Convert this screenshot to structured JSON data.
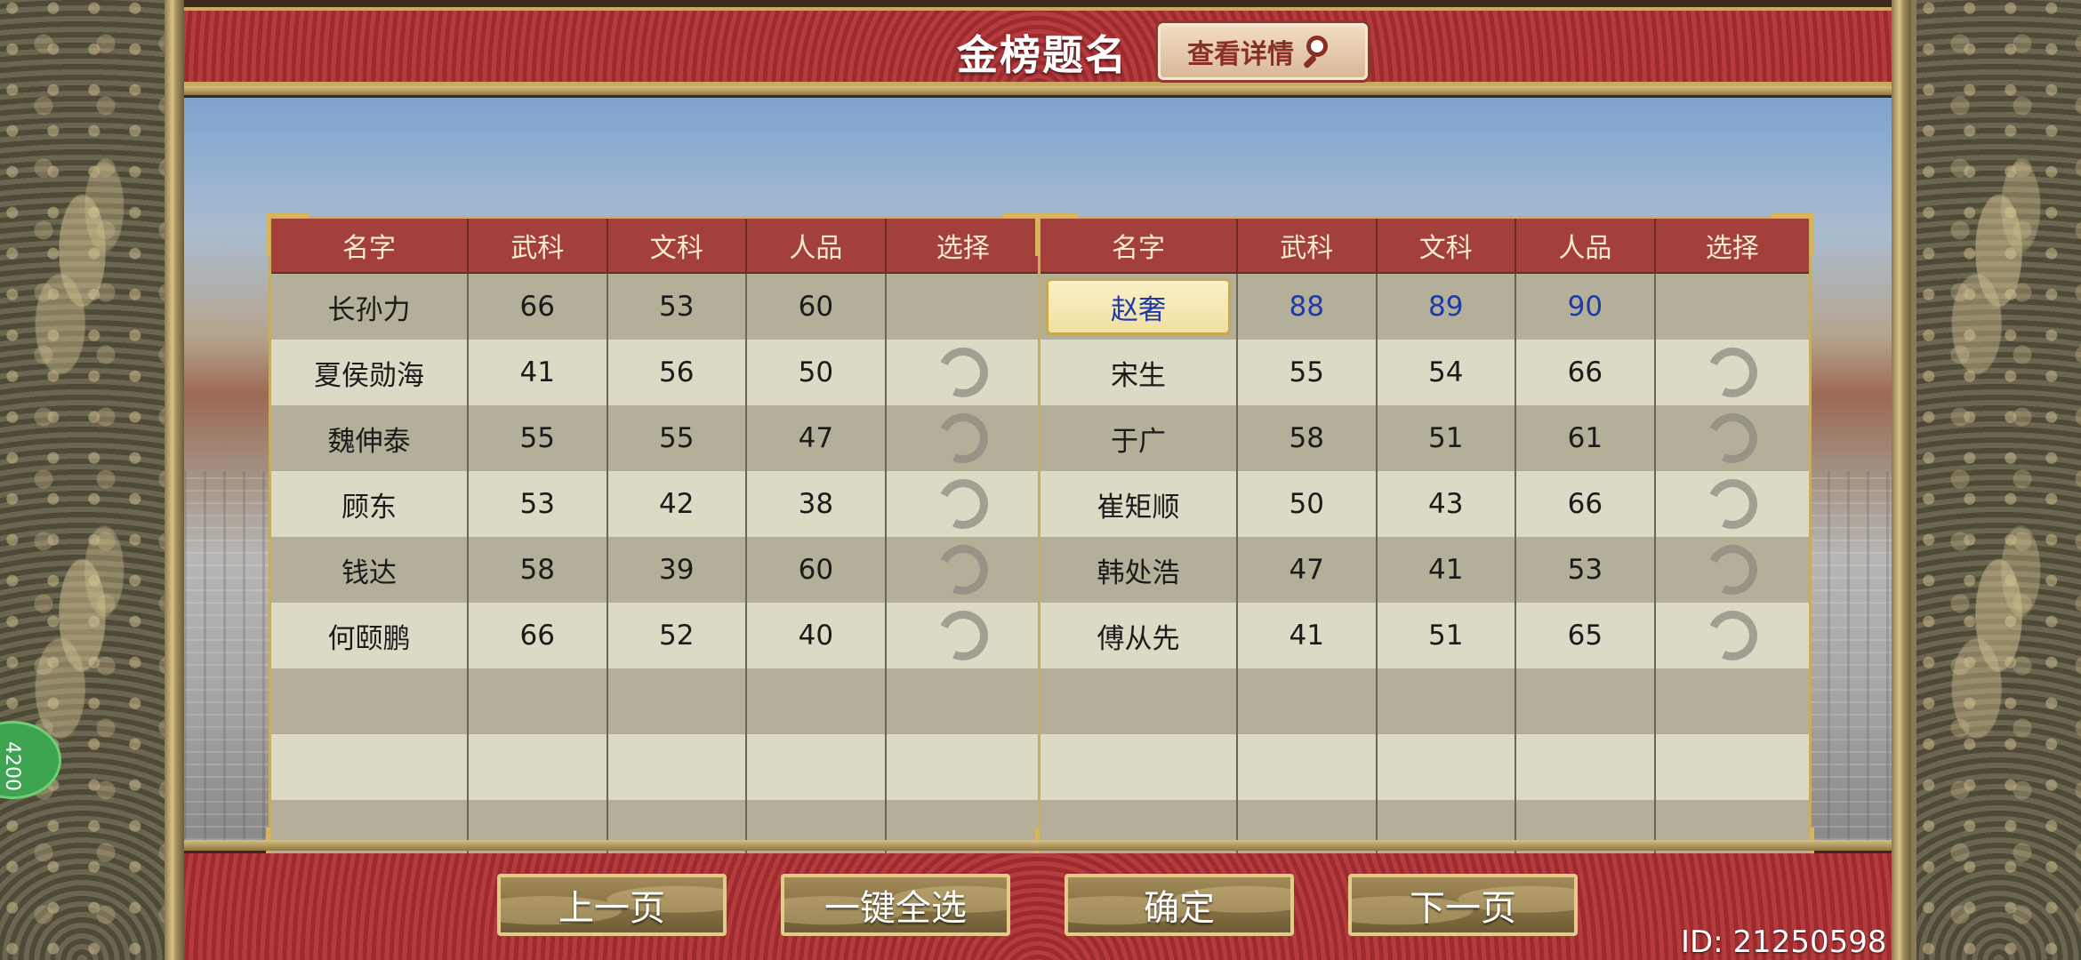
{
  "header": {
    "title": "金榜题名",
    "detail_button": "查看详情"
  },
  "table_left": {
    "columns": [
      "名字",
      "武科",
      "文科",
      "人品",
      "选择"
    ],
    "rows": [
      {
        "name": "长孙力",
        "wu": "66",
        "wen": "53",
        "renpin": "60",
        "select": false
      },
      {
        "name": "夏侯勋海",
        "wu": "41",
        "wen": "56",
        "renpin": "50",
        "select": true
      },
      {
        "name": "魏伸泰",
        "wu": "55",
        "wen": "55",
        "renpin": "47",
        "select": true
      },
      {
        "name": "顾东",
        "wu": "53",
        "wen": "42",
        "renpin": "38",
        "select": true
      },
      {
        "name": "钱达",
        "wu": "58",
        "wen": "39",
        "renpin": "60",
        "select": true
      },
      {
        "name": "何颐鹏",
        "wu": "66",
        "wen": "52",
        "renpin": "40",
        "select": true
      }
    ]
  },
  "table_right": {
    "columns": [
      "名字",
      "武科",
      "文科",
      "人品",
      "选择"
    ],
    "rows": [
      {
        "name": "赵奢",
        "wu": "88",
        "wen": "89",
        "renpin": "90",
        "select": false,
        "highlight": true
      },
      {
        "name": "宋生",
        "wu": "55",
        "wen": "54",
        "renpin": "66",
        "select": true
      },
      {
        "name": "于广",
        "wu": "58",
        "wen": "51",
        "renpin": "61",
        "select": true
      },
      {
        "name": "崔矩顺",
        "wu": "50",
        "wen": "43",
        "renpin": "66",
        "select": true
      },
      {
        "name": "韩处浩",
        "wu": "47",
        "wen": "41",
        "renpin": "53",
        "select": true
      },
      {
        "name": "傅从先",
        "wu": "41",
        "wen": "51",
        "renpin": "65",
        "select": true
      }
    ]
  },
  "footer": {
    "prev_page": "上一页",
    "select_all": "一键全选",
    "confirm": "确定",
    "next_page": "下一页",
    "id_text": "ID: 21250598"
  },
  "side_badge": "4200",
  "colors": {
    "header_red": "#a3403b",
    "gold": "#c8ac62",
    "highlight_blue": "#1f3aa6"
  }
}
